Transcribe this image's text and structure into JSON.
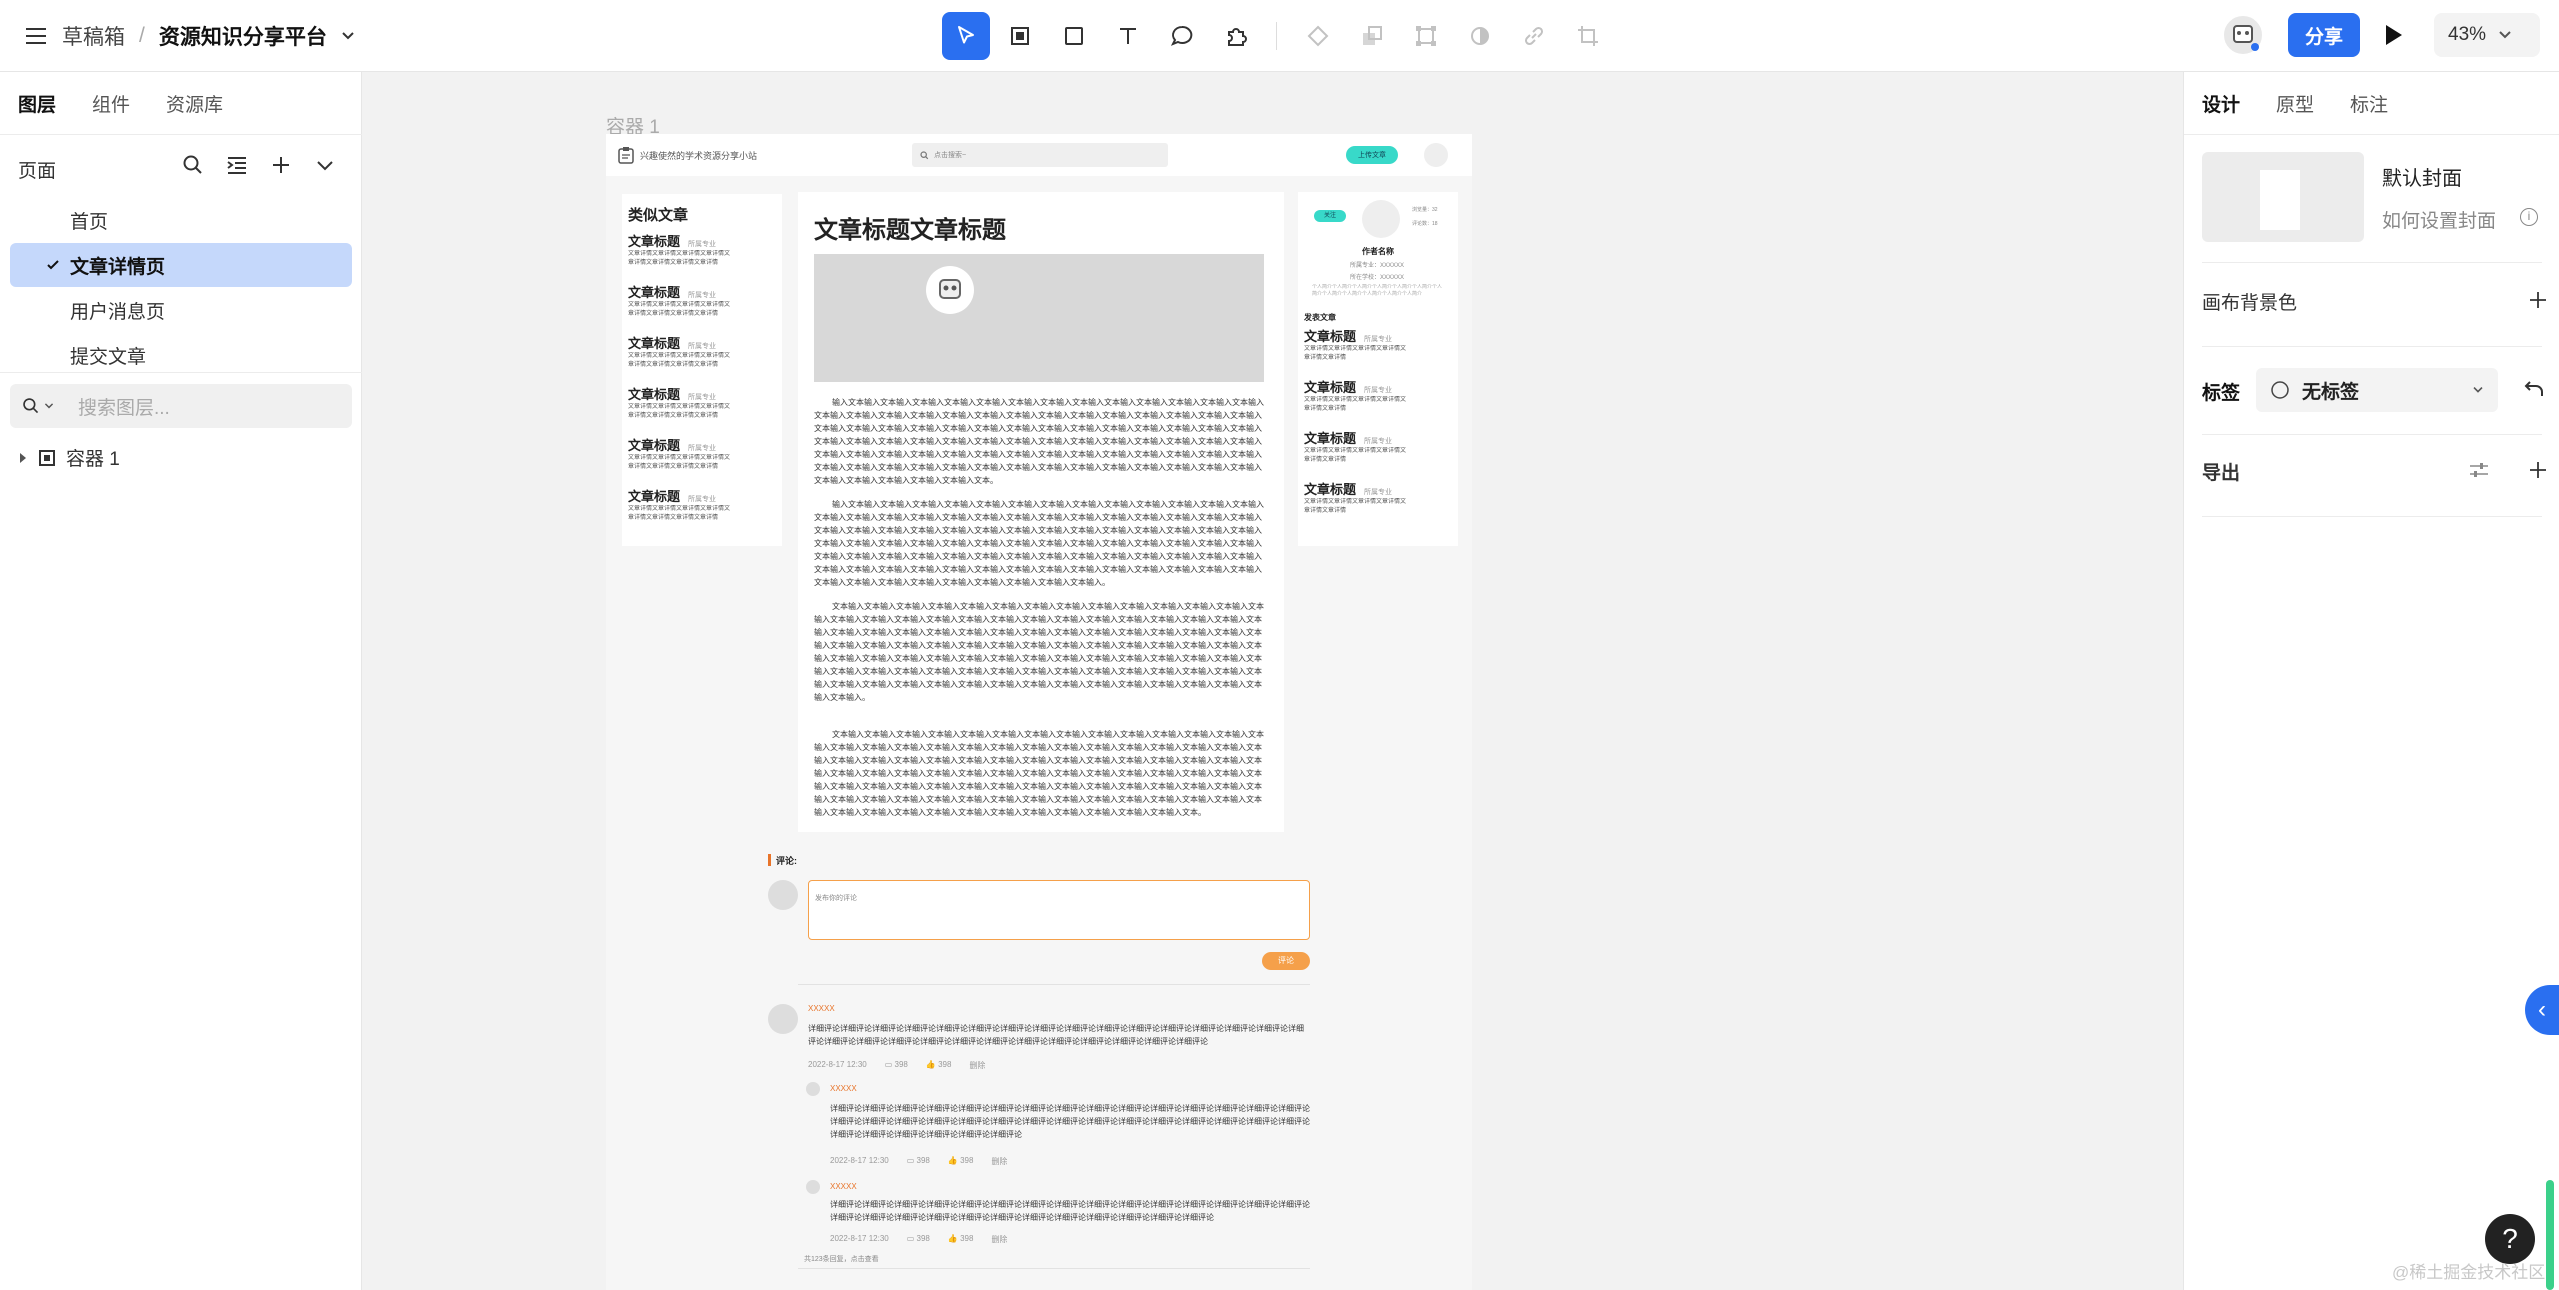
{
  "topbar": {
    "breadcrumb_root": "草稿箱",
    "breadcrumb_sep": "/",
    "project_name": "资源知识分享平台",
    "share_label": "分享",
    "zoom": "43%"
  },
  "left_panel": {
    "tabs": [
      "图层",
      "组件",
      "资源库"
    ],
    "pages_title": "页面",
    "pages": [
      {
        "label": "首页"
      },
      {
        "label": "文章详情页",
        "selected": true
      },
      {
        "label": "用户消息页"
      },
      {
        "label": "提交文章"
      }
    ],
    "search_placeholder": "搜索图层...",
    "layers": [
      {
        "label": "容器 1"
      }
    ]
  },
  "right_panel": {
    "tabs": [
      "设计",
      "原型",
      "标注"
    ],
    "cover_title": "默认封面",
    "cover_help": "如何设置封面",
    "canvas_bg": "画布背景色",
    "tag_label": "标签",
    "tag_value": "无标签",
    "export_label": "导出"
  },
  "canvas": {
    "frame_label": "容器 1",
    "site": {
      "logo_text": "兴趣使然的学术资源分享小站",
      "search_placeholder": "点击搜索~",
      "upload_label": "上传文章",
      "similar_title": "类似文章",
      "similar_items": [
        {
          "title": "文章标题",
          "meta": "所属专业",
          "desc": "文章详情文章详情文章详情文章详情文章详情文章详情文章详情文章详情"
        },
        {
          "title": "文章标题",
          "meta": "所属专业",
          "desc": "文章详情文章详情文章详情文章详情文章详情文章详情文章详情文章详情"
        },
        {
          "title": "文章标题",
          "meta": "所属专业",
          "desc": "文章详情文章详情文章详情文章详情文章详情文章详情文章详情文章详情"
        },
        {
          "title": "文章标题",
          "meta": "所属专业",
          "desc": "文章详情文章详情文章详情文章详情文章详情文章详情文章详情文章详情"
        },
        {
          "title": "文章标题",
          "meta": "所属专业",
          "desc": "文章详情文章详情文章详情文章详情文章详情文章详情文章详情文章详情"
        },
        {
          "title": "文章标题",
          "meta": "所属专业",
          "desc": "文章详情文章详情文章详情文章详情文章详情文章详情文章详情文章详情"
        }
      ],
      "article_title": "文章标题文章标题",
      "paragraphs": [
        "输入文本输入文本输入文本输入文本输入文本输入文本输入文本输入文本输入文本输入文本输入文本输入文本输入文本输入文本输入文本输入文本输入文本输入文本输入文本输入文本输入文本输入文本输入文本输入文本输入文本输入文本输入文本输入文本输入文本输入文本输入文本输入文本输入文本输入文本输入文本输入文本输入文本输入文本输入文本输入文本输入文本输入文本输入文本输入文本输入文本输入文本输入文本输入文本输入文本输入文本输入文本输入文本输入文本输入文本输入文本输入文本输入文本输入文本输入文本输入文本输入文本输入文本输入文本输入文本输入文本输入文本输入文本输入文本输入文本输入文本输入文本输入文本输入文本输入文本输入文本输入文本输入文本输入文本输入文本输入文本输入文本输入文本输入文本输入文本输入文本输入文本输入文本输入文本输入文本。",
        "输入文本输入文本输入文本输入文本输入文本输入文本输入文本输入文本输入文本输入文本输入文本输入文本输入文本输入文本输入文本输入文本输入文本输入文本输入文本输入文本输入文本输入文本输入文本输入文本输入文本输入文本输入文本输入文本输入文本输入文本输入文本输入文本输入文本输入文本输入文本输入文本输入文本输入文本输入文本输入文本输入文本输入文本输入文本输入文本输入文本输入文本输入文本输入文本输入文本输入文本输入文本输入文本输入文本输入文本输入文本输入文本输入文本输入文本输入文本输入文本输入文本输入文本输入文本输入文本输入文本输入文本输入文本输入文本输入文本输入文本输入文本输入文本输入文本输入文本输入文本输入文本输入文本输入文本输入文本输入文本输入文本输入文本输入文本输入文本输入文本输入文本输入文本输入文本输入文本输入文本输入文本输入文本输入。",
        "文本输入文本输入文本输入文本输入文本输入文本输入文本输入文本输入文本输入文本输入文本输入文本输入文本输入文本输入文本输入文本输入文本输入文本输入文本输入文本输入文本输入文本输入文本输入文本输入文本输入文本输入文本输入文本输入文本输入文本输入文本输入文本输入文本输入文本输入文本输入文本输入文本输入文本输入文本输入文本输入文本输入文本输入文本输入文本输入文本输入文本输入文本输入文本输入文本输入文本输入文本输入文本输入文本输入文本输入文本输入文本输入文本输入文本输入文本输入文本输入文本输入文本输入文本输入文本输入文本输入文本输入文本输入文本输入文本输入文本输入文本输入文本输入文本输入文本输入文本输入文本输入文本输入文本输入文本输入文本输入文本输入文本输入文本输入文本输入文本输入文本输入文本输入文本输入文本输入文本输入文本输入文本输入文本输入文本输入文本输入文本输入文本输入文本输入文本输入。",
        "文本输入文本输入文本输入文本输入文本输入文本输入文本输入文本输入文本输入文本输入文本输入文本输入文本输入文本输入文本输入文本输入文本输入文本输入文本输入文本输入文本输入文本输入文本输入文本输入文本输入文本输入文本输入文本输入文本输入文本输入文本输入文本输入文本输入文本输入文本输入文本输入文本输入文本输入文本输入文本输入文本输入文本输入文本输入文本输入文本输入文本输入文本输入文本输入文本输入文本输入文本输入文本输入文本输入文本输入文本输入文本输入文本输入文本输入文本输入文本输入文本输入文本输入文本输入文本输入文本输入文本输入文本输入文本输入文本输入文本输入文本输入文本输入文本输入文本输入文本输入文本输入文本输入文本输入文本输入文本输入文本输入文本输入文本输入文本输入文本输入文本输入文本输入文本输入文本输入文本输入文本输入文本输入文本输入文本输入文本输入文本。"
      ],
      "author": {
        "badge": "关注",
        "stat1": "浏览量：32",
        "stat2": "评论数：18",
        "name": "作者名称",
        "major": "所属专业：XXXXXX",
        "school": "所在学校：XXXXXX",
        "bio": "个人简介个人简介个人简介个人简介个人简介个人简介个人简介个人简介个人简介个人简介个人简介个人简介",
        "posts_title": "发表文章",
        "posts": [
          {
            "title": "文章标题",
            "meta": "所属专业",
            "desc": "文章详情文章详情文章详情文章详情文章详情文章详情"
          },
          {
            "title": "文章标题",
            "meta": "所属专业",
            "desc": "文章详情文章详情文章详情文章详情文章详情文章详情"
          },
          {
            "title": "文章标题",
            "meta": "所属专业",
            "desc": "文章详情文章详情文章详情文章详情文章详情文章详情"
          },
          {
            "title": "文章标题",
            "meta": "所属专业",
            "desc": "文章详情文章详情文章详情文章详情文章详情文章详情"
          }
        ]
      },
      "comments": {
        "title": "评论:",
        "input_placeholder": "发布你的评论",
        "submit_label": "评论",
        "items": [
          {
            "name": "XXXXX",
            "text": "详细评论详细评论详细评论详细评论详细评论详细评论详细评论详细评论详细评论详细评论详细评论详细评论详细评论详细评论详细评论详细评论详细评论详细评论详细评论详细评论详细评论详细评论详细评论详细评论详细评论详细评论详细评论详细评论",
            "date": "2022-8-17  12:30",
            "replies": "398",
            "likes": "398",
            "delete": "删除"
          },
          {
            "name": "XXXXX",
            "text": "详细评论详细评论详细评论详细评论详细评论详细评论详细评论详细评论详细评论详细评论详细评论详细评论详细评论详细评论详细评论详细评论详细评论详细评论详细评论详细评论详细评论详细评论详细评论详细评论详细评论详细评论详细评论详细评论详细评论详细评论详细评论详细评论详细评论详细评论详细评论详细评论",
            "date": "2022-8-17  12:30",
            "replies": "398",
            "likes": "398",
            "delete": "删除"
          },
          {
            "name": "XXXXX",
            "text": "详细评论详细评论详细评论详细评论详细评论详细评论详细评论详细评论详细评论详细评论详细评论详细评论详细评论详细评论详细评论详细评论详细评论详细评论详细评论详细评论详细评论详细评论详细评论详细评论详细评论详细评论详细评论",
            "date": "2022-8-17  12:30",
            "replies": "398",
            "likes": "398",
            "delete": "删除"
          }
        ],
        "footer": "共123条回复，点击查看"
      }
    }
  },
  "help_label": "?",
  "watermark": "@稀土掘金技术社区",
  "colors": {
    "accent": "#2a6ff0",
    "selected_page": "#c5d8fb",
    "orange": "#f5a04a",
    "teal": "#38d9c9"
  }
}
